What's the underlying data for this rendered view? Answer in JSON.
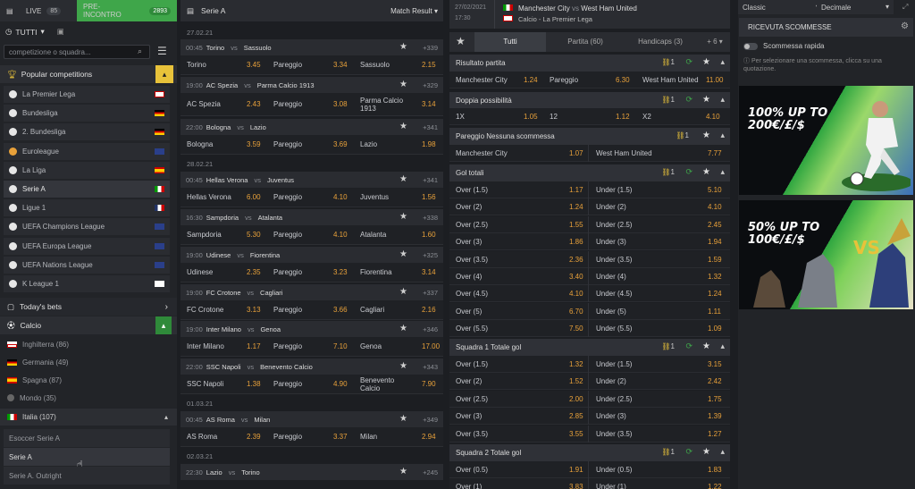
{
  "col1": {
    "live_label": "LIVE",
    "live_count": "85",
    "pre_label": "PRE-INCONTRO",
    "pre_count": "2893",
    "tutti": "TUTTI",
    "search_placeholder": "competizione o squadra...",
    "popular_title": "Popular competitions",
    "popular": [
      {
        "label": "La Premier Lega"
      },
      {
        "label": "Bundesliga"
      },
      {
        "label": "2. Bundesliga"
      },
      {
        "label": "Euroleague"
      },
      {
        "label": "La Liga"
      },
      {
        "label": "Serie A"
      },
      {
        "label": "Ligue 1"
      },
      {
        "label": "UEFA Champions League"
      },
      {
        "label": "UEFA Europa League"
      },
      {
        "label": "UEFA Nations League"
      },
      {
        "label": "K League 1"
      }
    ],
    "todays_bets": "Today's bets",
    "calcio": "Calcio",
    "countries": [
      {
        "label": "Inghilterra (86)"
      },
      {
        "label": "Germania (49)"
      },
      {
        "label": "Spagna (87)"
      },
      {
        "label": "Mondo (35)"
      }
    ],
    "italia": "Italia (107)",
    "sub": [
      {
        "label": "Esoccer Serie A"
      },
      {
        "label": "Serie A"
      },
      {
        "label": "Serie A. Outright"
      }
    ]
  },
  "col2": {
    "title": "Serie A",
    "market": "Match Result",
    "dates": [
      "27.02.21",
      "28.02.21",
      "01.03.21",
      "02.03.21"
    ],
    "matches": [
      {
        "time": "00:45",
        "home": "Torino",
        "away": "Sassuolo",
        "more": "+339",
        "o1": "3.45",
        "ox": "Pareggio",
        "oxv": "3.34",
        "o2": "Sassuolo",
        "o2v": "2.15"
      },
      {
        "time": "19:00",
        "home": "AC Spezia",
        "away": "Parma Calcio 1913",
        "more": "+329",
        "o1": "2.43",
        "ox": "Pareggio",
        "oxv": "3.08",
        "o2": "Parma Calcio 1913",
        "o2v": "3.14"
      },
      {
        "time": "22:00",
        "home": "Bologna",
        "away": "Lazio",
        "more": "+341",
        "o1": "3.59",
        "ox": "Pareggio",
        "oxv": "3.69",
        "o2": "Lazio",
        "o2v": "1.98"
      },
      {
        "time": "00:45",
        "home": "Hellas Verona",
        "away": "Juventus",
        "more": "+341",
        "o1": "6.00",
        "ox": "Pareggio",
        "oxv": "4.10",
        "o2": "Juventus",
        "o2v": "1.56"
      },
      {
        "time": "16:30",
        "home": "Sampdoria",
        "away": "Atalanta",
        "more": "+338",
        "o1": "5.30",
        "ox": "Pareggio",
        "oxv": "4.10",
        "o2": "Atalanta",
        "o2v": "1.60"
      },
      {
        "time": "19:00",
        "home": "Udinese",
        "away": "Fiorentina",
        "more": "+325",
        "o1": "2.35",
        "ox": "Pareggio",
        "oxv": "3.23",
        "o2": "Fiorentina",
        "o2v": "3.14"
      },
      {
        "time": "19:00",
        "home": "FC Crotone",
        "away": "Cagliari",
        "more": "+337",
        "o1": "3.13",
        "ox": "Pareggio",
        "oxv": "3.66",
        "o2": "Cagliari",
        "o2v": "2.16"
      },
      {
        "time": "19:00",
        "home": "Inter Milano",
        "away": "Genoa",
        "more": "+346",
        "o1": "1.17",
        "ox": "Pareggio",
        "oxv": "7.10",
        "o2": "Genoa",
        "o2v": "17.00"
      },
      {
        "time": "22:00",
        "home": "SSC Napoli",
        "away": "Benevento Calcio",
        "more": "+343",
        "o1": "1.38",
        "ox": "Pareggio",
        "oxv": "4.90",
        "o2": "Benevento Calcio",
        "o2v": "7.90"
      },
      {
        "time": "00:45",
        "home": "AS Roma",
        "away": "Milan",
        "more": "+349",
        "o1": "2.39",
        "ox": "Pareggio",
        "oxv": "3.37",
        "o2": "Milan",
        "o2v": "2.94"
      },
      {
        "time": "22:30",
        "home": "Lazio",
        "away": "Torino",
        "more": "+245"
      }
    ],
    "vs": "vs"
  },
  "col3": {
    "date": "27/02/2021",
    "time": "17:30",
    "home": "Manchester City",
    "vs": "vs",
    "away": "West Ham United",
    "league": "Calcio - La Premier Lega",
    "tabs": [
      {
        "label": "Tutti"
      },
      {
        "label": "Partita (60)"
      },
      {
        "label": "Handicaps (3)"
      },
      {
        "label": "+ 6"
      }
    ],
    "risultato": {
      "title": "Risultato partita",
      "link": "1",
      "a": "Manchester City",
      "av": "1.24",
      "b": "Pareggio",
      "bv": "6.30",
      "c": "West Ham United",
      "cv": "11.00"
    },
    "doppia": {
      "title": "Doppia possibilità",
      "link": "1",
      "a": "1X",
      "av": "1.05",
      "b": "12",
      "bv": "1.12",
      "c": "X2",
      "cv": "4.10"
    },
    "pareggio": {
      "title": "Pareggio Nessuna scommessa",
      "link": "1",
      "a": "Manchester City",
      "av": "1.07",
      "b": "West Ham United",
      "bv": "7.77"
    },
    "gol_totali": {
      "title": "Gol totali",
      "link": "1",
      "rows": [
        {
          "o": "Over (1.5)",
          "ov": "1.17",
          "u": "Under (1.5)",
          "uv": "5.10"
        },
        {
          "o": "Over (2)",
          "ov": "1.24",
          "u": "Under (2)",
          "uv": "4.10"
        },
        {
          "o": "Over (2.5)",
          "ov": "1.55",
          "u": "Under (2.5)",
          "uv": "2.45"
        },
        {
          "o": "Over (3)",
          "ov": "1.86",
          "u": "Under (3)",
          "uv": "1.94"
        },
        {
          "o": "Over (3.5)",
          "ov": "2.36",
          "u": "Under (3.5)",
          "uv": "1.59"
        },
        {
          "o": "Over (4)",
          "ov": "3.40",
          "u": "Under (4)",
          "uv": "1.32"
        },
        {
          "o": "Over (4.5)",
          "ov": "4.10",
          "u": "Under (4.5)",
          "uv": "1.24"
        },
        {
          "o": "Over (5)",
          "ov": "6.70",
          "u": "Under (5)",
          "uv": "1.11"
        },
        {
          "o": "Over (5.5)",
          "ov": "7.50",
          "u": "Under (5.5)",
          "uv": "1.09"
        }
      ]
    },
    "sq1": {
      "title": "Squadra 1 Totale gol",
      "link": "1",
      "rows": [
        {
          "o": "Over (1.5)",
          "ov": "1.32",
          "u": "Under (1.5)",
          "uv": "3.15"
        },
        {
          "o": "Over (2)",
          "ov": "1.52",
          "u": "Under (2)",
          "uv": "2.42"
        },
        {
          "o": "Over (2.5)",
          "ov": "2.00",
          "u": "Under (2.5)",
          "uv": "1.75"
        },
        {
          "o": "Over (3)",
          "ov": "2.85",
          "u": "Under (3)",
          "uv": "1.39"
        },
        {
          "o": "Over (3.5)",
          "ov": "3.55",
          "u": "Under (3.5)",
          "uv": "1.27"
        }
      ]
    },
    "sq2": {
      "title": "Squadra 2 Totale gol",
      "link": "1",
      "rows": [
        {
          "o": "Over (0.5)",
          "ov": "1.91",
          "u": "Under (0.5)",
          "uv": "1.83"
        },
        {
          "o": "Over (1)",
          "ov": "3.83",
          "u": "Under (1)",
          "uv": "1.22"
        }
      ]
    }
  },
  "col4": {
    "classic": "Classic",
    "decimale": "Decimale",
    "ricevuta": "RICEVUTA SCOMMESSE",
    "rapida": "Scommessa rapida",
    "info": "Per selezionare una scommessa, clicca su una quotazione.",
    "promo1": "100% UP TO 200€/£/$",
    "promo2": "50% UP TO 100€/£/$"
  },
  "colors": {
    "green": "#3fa64a",
    "odds": "#e8a13a",
    "panel": "#2a2c31",
    "bg": "#1c1e22"
  }
}
